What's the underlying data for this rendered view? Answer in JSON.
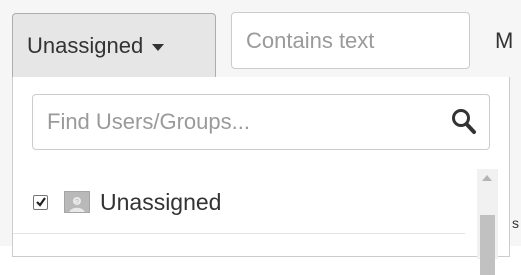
{
  "toolbar": {
    "assignee_filter_label": "Unassigned",
    "text_filter_placeholder": "Contains text",
    "more_label": "M"
  },
  "dropdown": {
    "search_placeholder": "Find Users/Groups...",
    "options": [
      {
        "label": "Unassigned",
        "checked": true,
        "icon": "user-avatar-icon"
      }
    ]
  },
  "peek_text": "s"
}
